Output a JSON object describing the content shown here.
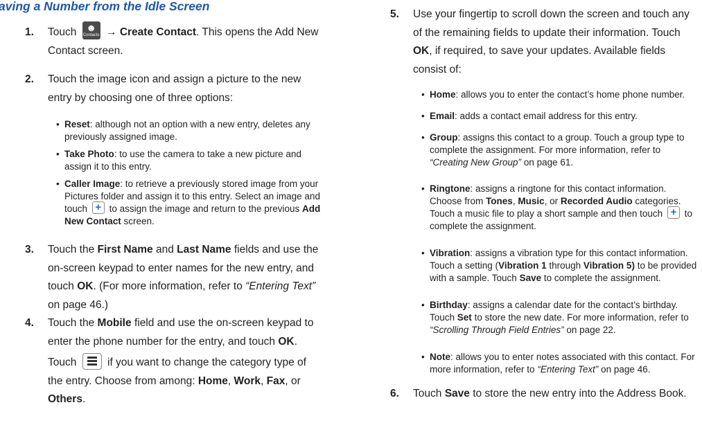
{
  "heading": "aving a Number from the Idle Screen",
  "steps": {
    "s1": {
      "num": "1.",
      "touch": "Touch",
      "icon_label": "Contacts",
      "arrow": "→",
      "bold1": "Create Contact",
      "rest": ". This opens the Add New Contact screen."
    },
    "s2": {
      "num": "2.",
      "text": "Touch the image icon and assign a picture to the new entry by choosing one of three options:"
    },
    "s2b1": {
      "label": "Reset",
      "text": ": although not an option with a new entry, deletes any previously assigned image."
    },
    "s2b2": {
      "label": "Take Photo",
      "text": ": to use the camera to take a new picture and assign it to this entry."
    },
    "s2b3": {
      "label": "Caller Image",
      "text1": ": to retrieve a previously stored image from your Pictures folder and assign it to this entry. Select an image and touch",
      "text2": "to assign the image and return to the previous",
      "bold": "Add New Contact",
      "text3": "screen."
    },
    "s3": {
      "num": "3.",
      "a": "Touch the",
      "b1": "First Name",
      "c": "and",
      "b2": "Last Name",
      "d": "fields and use the on-screen keypad to enter names for the new entry, and touch",
      "b3": "OK",
      "e": ". (For more information, refer to",
      "ref": "“Entering Text”",
      "f": "on page 46.)"
    },
    "s4": {
      "num": "4.",
      "a": "Touch the",
      "b1": "Mobile",
      "c": "field and use the on-screen keypad to enter the phone number for the entry, and touch",
      "b2": "OK",
      "d": "."
    },
    "s4p": {
      "a": "Touch",
      "b": "if you want to change the category type of the entry. Choose from among:",
      "o1": "Home",
      "o2": "Work",
      "o3": "Fax",
      "or": "or",
      "o4": "Others",
      "sep": ", "
    },
    "s5": {
      "num": "5.",
      "a": "Use your fingertip to scroll down the screen and touch any of the remaining fields to update their information. Touch",
      "b": "OK",
      "c": ", if required, to save your updates. Available fields consist of:"
    },
    "r1": {
      "label": "Home",
      "text": ": allows you to enter the contact’s home phone number."
    },
    "r2": {
      "label": "Email",
      "text": ": adds a contact email address for this entry."
    },
    "r3": {
      "label": "Group",
      "text": ": assigns this contact to a group. Touch a group type to complete the assignment. For more information, refer to",
      "ref": "“Creating New Group”",
      "page": "on page 61."
    },
    "r4": {
      "label": "Ringtone",
      "a": ": assigns a ringtone for this contact information. Choose from",
      "t1": "Tones",
      "t2": "Music",
      "or": ", or",
      "t3": "Recorded Audio",
      "b": "categories. Touch a music file to play a short sample and then touch",
      "c": "to complete the assignment."
    },
    "r5": {
      "label": "Vibration",
      "a": ": assigns a vibration type for this contact information. Touch a setting (",
      "v1": "Vibration 1",
      "through": "through",
      "v2": "Vibration 5)",
      "b": "to be provided with a sample. Touch",
      "save": "Save",
      "c": "to complete the assignment."
    },
    "r6": {
      "label": "Birthday",
      "a": ": assigns a calendar date for the contact’s birthday. Touch",
      "set": "Set",
      "b": "to store the new date. For more information, refer to",
      "ref": "“Scrolling Through Field Entries”",
      "page": "on page 22."
    },
    "r7": {
      "label": "Note",
      "a": ": allows you to enter notes associated with this contact. For more information, refer to",
      "ref": "“Entering Text”",
      "page": "on page 46."
    },
    "s6": {
      "num": "6.",
      "a": "Touch",
      "b": "Save",
      "c": "to store the new entry into the Address Book."
    }
  }
}
